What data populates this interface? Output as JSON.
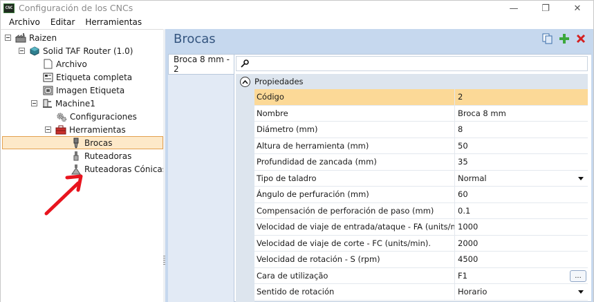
{
  "window": {
    "icon_text": "CNC",
    "title": "Configuración de los CNCs",
    "controls": {
      "minimize": "—",
      "maximize": "❐",
      "close": "✕"
    }
  },
  "menu": {
    "items": [
      "Archivo",
      "Editar",
      "Herramientas"
    ]
  },
  "tree": {
    "root": "Raizen",
    "router": "Solid TAF Router (1.0)",
    "archivo": "Archivo",
    "etiqueta_completa": "Etiqueta completa",
    "imagen_etiqueta": "Imagen Etiqueta",
    "machine": "Machine1",
    "configuraciones": "Configuraciones",
    "herramientas": "Herramientas",
    "brocas": "Brocas",
    "ruteadoras": "Ruteadoras",
    "ruteadoras_conicas": "Ruteadoras Cónicas"
  },
  "panel": {
    "title": "Brocas",
    "tab": "Broca 8 mm - 2",
    "search_placeholder": "",
    "category": "Propiedades"
  },
  "properties": [
    {
      "name": "Código",
      "value": "2"
    },
    {
      "name": "Nombre",
      "value": "Broca 8 mm"
    },
    {
      "name": "Diámetro (mm)",
      "value": "8"
    },
    {
      "name": "Altura de herramienta (mm)",
      "value": "50"
    },
    {
      "name": "Profundidad de zancada (mm)",
      "value": "35"
    },
    {
      "name": "Tipo de taladro",
      "value": "Normal"
    },
    {
      "name": "Ángulo de perfuración (mm)",
      "value": "60"
    },
    {
      "name": "Compensación de perforación de paso (mm)",
      "value": "0.1"
    },
    {
      "name": "Velocidad de viaje de entrada/ataque - FA (units/min)",
      "value": "1000"
    },
    {
      "name": "Velocidad de viaje de corte - FC (units/min).",
      "value": "2000"
    },
    {
      "name": "Velocidad de rotación - S (rpm)",
      "value": "4500"
    },
    {
      "name": "Cara de utilização",
      "value": "F1"
    },
    {
      "name": "Sentido de rotación",
      "value": "Horario"
    }
  ],
  "ellipsis_label": "...",
  "colors": {
    "accent_title": "#34557f",
    "selection_bg": "#fde9c9",
    "selection_border": "#e3a04f",
    "highlight_row": "#fcd997",
    "panel_bg": "#c6d8ee",
    "annotation_arrow": "#e8141e"
  },
  "icons": {
    "add": "plus-icon",
    "delete": "delete-x-icon",
    "copy": "copy-icon",
    "search": "key-search-icon",
    "collapse": "chevron-up-icon"
  }
}
